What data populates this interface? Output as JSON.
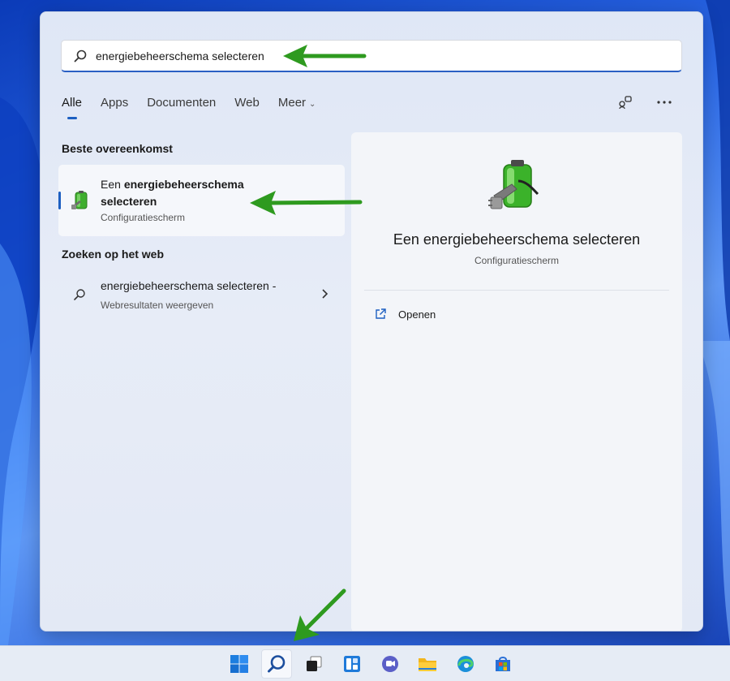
{
  "search": {
    "value": "energiebeheerschema selecteren",
    "icon": "search-icon"
  },
  "tabs": [
    {
      "label": "Alle",
      "active": true
    },
    {
      "label": "Apps",
      "active": false
    },
    {
      "label": "Documenten",
      "active": false
    },
    {
      "label": "Web",
      "active": false
    },
    {
      "label": "Meer",
      "active": false
    }
  ],
  "sections": {
    "best_match": "Beste overeenkomst",
    "web": "Zoeken op het web"
  },
  "best_match": {
    "title_prefix": "Een",
    "title_bold": "energiebeheerschema selecteren",
    "subtitle": "Configuratiescherm"
  },
  "web_result": {
    "title": "energiebeheerschema selecteren -",
    "subtitle": "Webresultaten weergeven"
  },
  "detail": {
    "title": "Een energiebeheerschema selecteren",
    "subtitle": "Configuratiescherm",
    "action_open": "Openen"
  },
  "colors": {
    "accent": "#1d5fc1",
    "arrow": "#2e9a1f"
  }
}
